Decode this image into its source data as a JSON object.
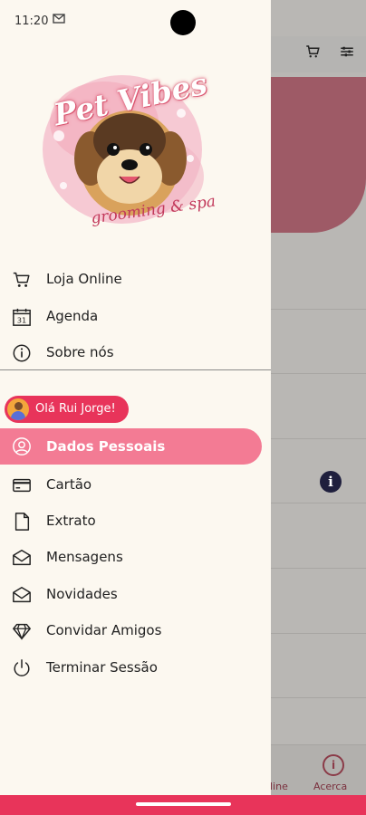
{
  "status_bar": {
    "time": "11:20",
    "mail_icon": "mail-icon"
  },
  "brand": {
    "title": "Pet Vibes",
    "subtitle": "grooming & spa",
    "accent": "#e8345a",
    "active_bg": "#f37b94"
  },
  "top_menu": [
    {
      "label": "Loja Online",
      "icon": "cart-icon"
    },
    {
      "label": "Agenda",
      "icon": "calendar-icon"
    },
    {
      "label": "Sobre nós",
      "icon": "info-icon"
    }
  ],
  "calendar_day": "31",
  "greeting": "Olá Rui Jorge!",
  "account_menu": [
    {
      "label": "Dados Pessoais",
      "icon": "user-icon",
      "active": true
    },
    {
      "label": "Cartão",
      "icon": "card-icon"
    },
    {
      "label": "Extrato",
      "icon": "document-icon"
    },
    {
      "label": "Mensagens",
      "icon": "envelope-icon"
    },
    {
      "label": "Novidades",
      "icon": "envelope-icon"
    },
    {
      "label": "Convidar Amigos",
      "icon": "diamond-icon"
    },
    {
      "label": "Terminar Sessão",
      "icon": "power-icon"
    }
  ],
  "background_nav": {
    "partial_label": "line",
    "acerca_label": "Acerca"
  }
}
